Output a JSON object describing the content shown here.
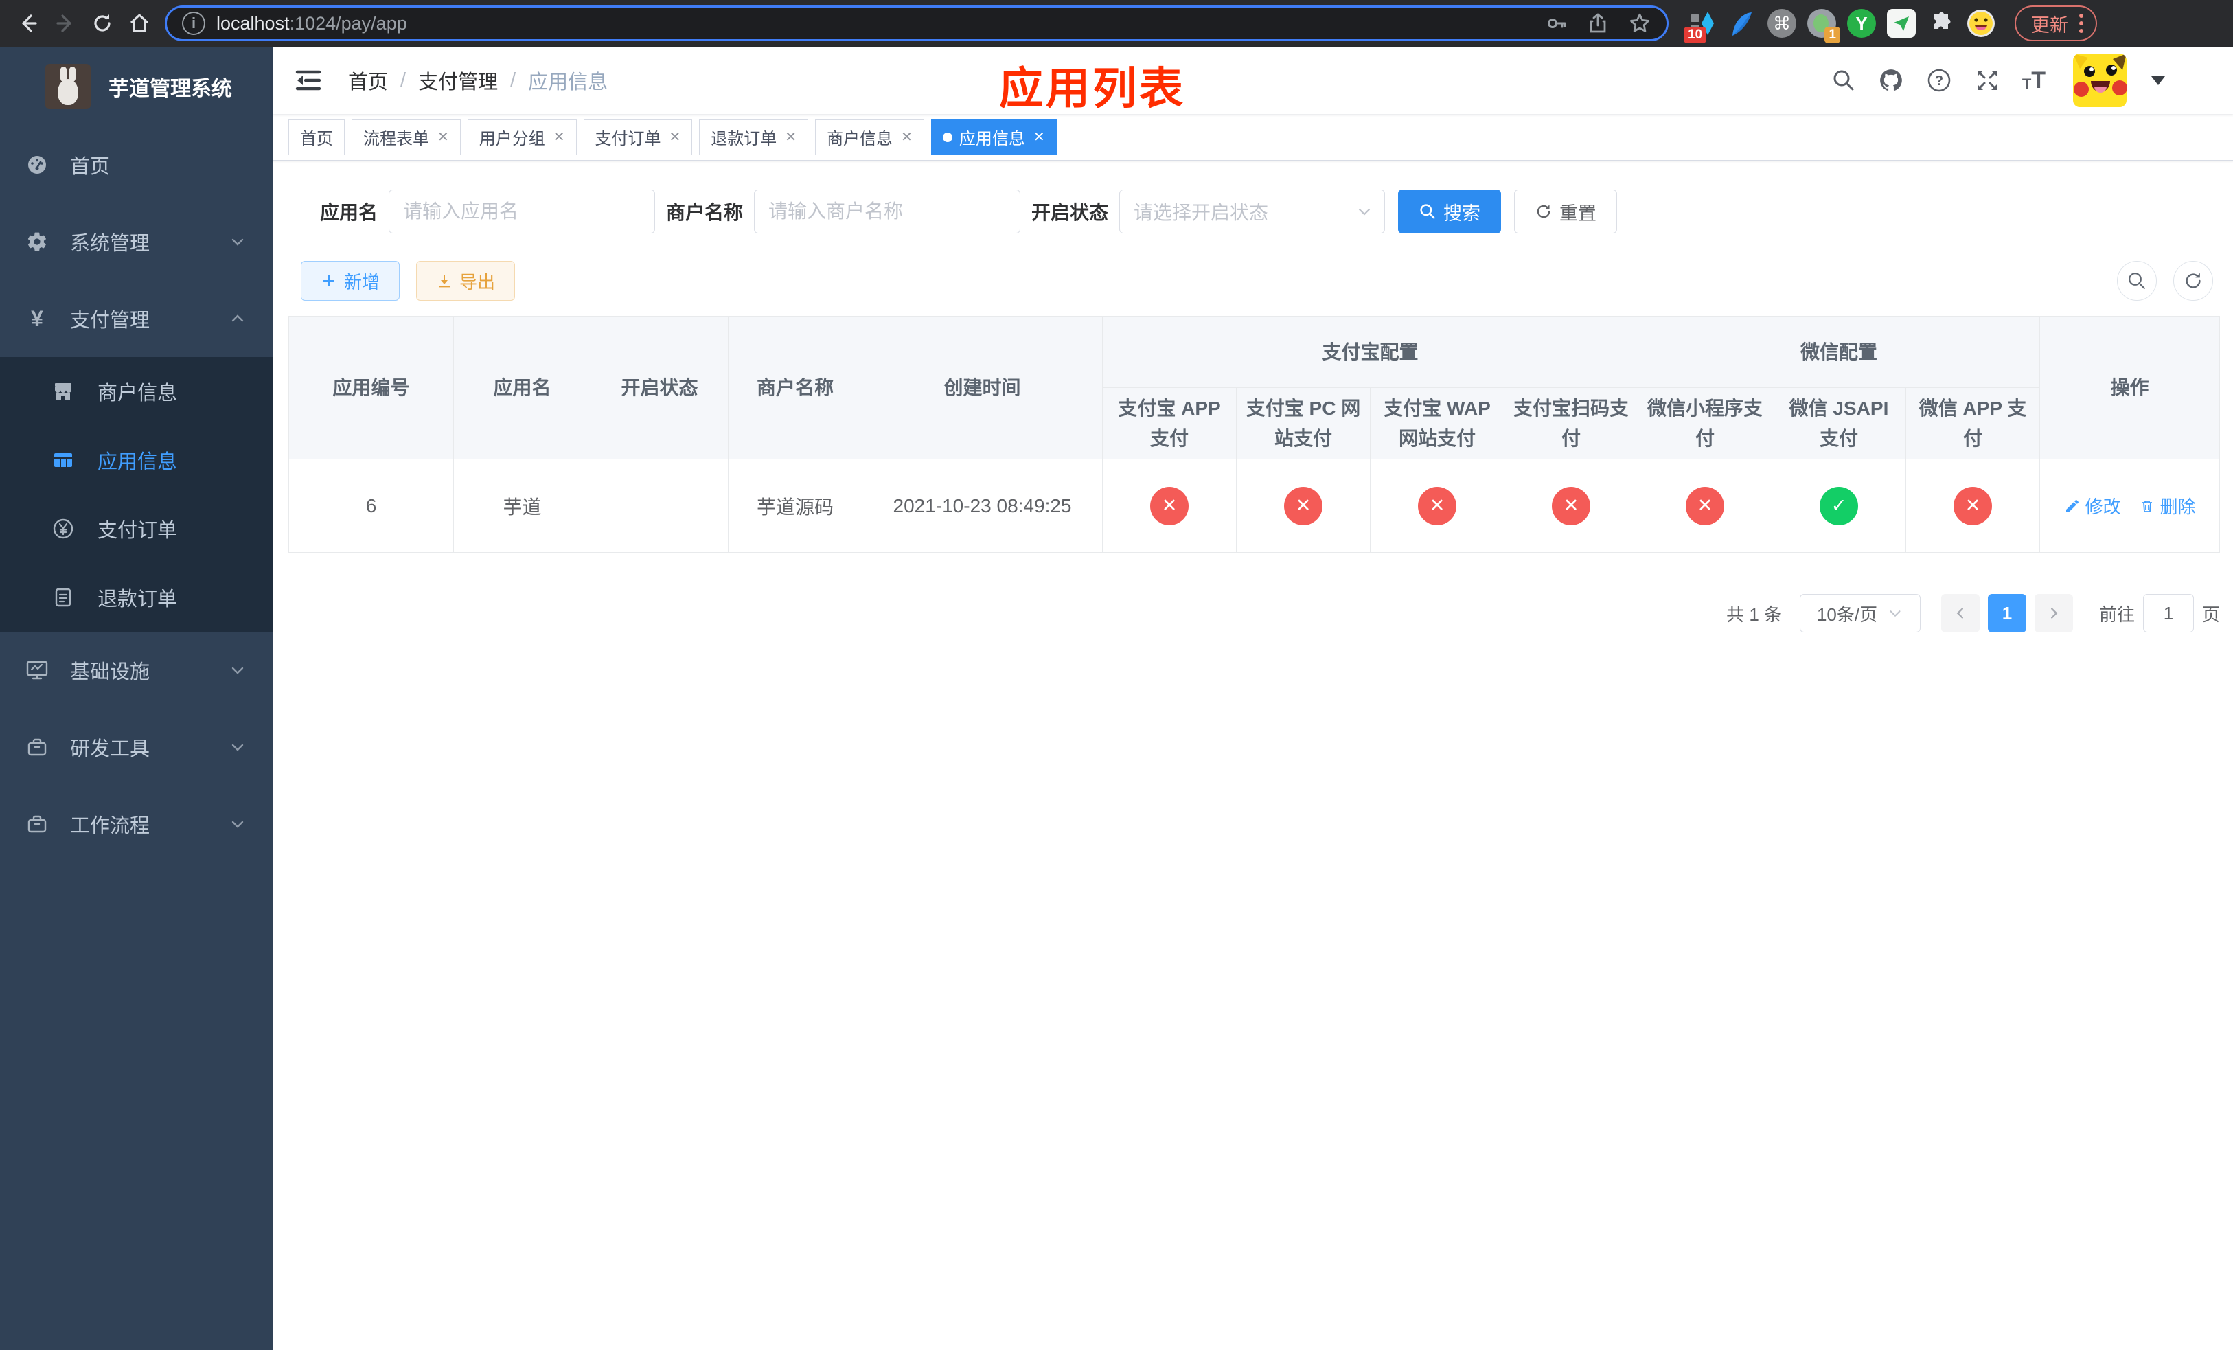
{
  "browser": {
    "url_host": "localhost",
    "url_path": ":1024/pay/app",
    "update_button": "更新",
    "ext_badge_blue": "10",
    "ext_badge_orange": "1"
  },
  "sidebar": {
    "title": "芋道管理系统",
    "menu": [
      {
        "label": "首页"
      },
      {
        "label": "系统管理"
      },
      {
        "label": "支付管理"
      },
      {
        "label": "基础设施"
      },
      {
        "label": "研发工具"
      },
      {
        "label": "工作流程"
      }
    ],
    "submenu": [
      {
        "label": "商户信息"
      },
      {
        "label": "应用信息"
      },
      {
        "label": "支付订单"
      },
      {
        "label": "退款订单"
      }
    ]
  },
  "navbar": {
    "breadcrumb": [
      "首页",
      "支付管理",
      "应用信息"
    ]
  },
  "tabs": [
    {
      "label": "首页"
    },
    {
      "label": "流程表单"
    },
    {
      "label": "用户分组"
    },
    {
      "label": "支付订单"
    },
    {
      "label": "退款订单"
    },
    {
      "label": "商户信息"
    },
    {
      "label": "应用信息"
    }
  ],
  "annotation": {
    "title": "应用列表",
    "color": "#ff2d00"
  },
  "filters": {
    "app_name": {
      "label": "应用名",
      "placeholder": "请输入应用名"
    },
    "merchant": {
      "label": "商户名称",
      "placeholder": "请输入商户名称"
    },
    "status": {
      "label": "开启状态",
      "placeholder": "请选择开启状态"
    },
    "search": "搜索",
    "reset": "重置"
  },
  "toolbar": {
    "add": "新增",
    "export": "导出"
  },
  "table": {
    "columns": [
      "应用编号",
      "应用名",
      "开启状态",
      "商户名称",
      "创建时间"
    ],
    "groups": [
      "支付宝配置",
      "微信配置"
    ],
    "pay_columns": [
      "支付宝 APP 支付",
      "支付宝 PC 网站支付",
      "支付宝 WAP 网站支付",
      "支付宝扫码支付",
      "微信小程序支付",
      "微信 JSAPI 支付",
      "微信 APP 支付"
    ],
    "action_column": "操作",
    "rows": [
      {
        "id": "6",
        "name": "芋道",
        "enabled": true,
        "merchant": "芋道源码",
        "created_at": "2021-10-23 08:49:25",
        "pay_status": [
          "fail",
          "fail",
          "fail",
          "fail",
          "fail",
          "success",
          "fail"
        ],
        "edit": "修改",
        "delete": "删除"
      }
    ]
  },
  "pagination": {
    "total": "共 1 条",
    "page_size": "10条/页",
    "current_page": "1",
    "goto_label": "前往",
    "goto_value": "1",
    "page_unit": "页"
  },
  "colors": {
    "accent": "#409eff",
    "primary_button": "#2d8cf0",
    "danger": "#f45b57",
    "success": "#13ce66",
    "sidebar_bg": "#304156",
    "submenu_bg": "#1f2d3d",
    "export": "#e6a23c"
  }
}
